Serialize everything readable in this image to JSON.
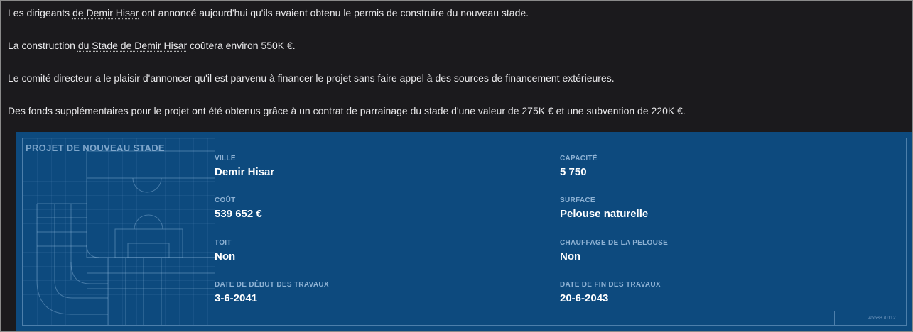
{
  "news": {
    "p1_before": "Les dirigeants ",
    "p1_link": "de Demir Hisar",
    "p1_after": " ont annoncé aujourd'hui qu'ils avaient obtenu le permis de construire du nouveau stade.",
    "p2_before": "La construction ",
    "p2_link": "du Stade de Demir Hisar",
    "p2_after": " coûtera environ 550K €.",
    "p3": "Le comité directeur a le plaisir d'annoncer qu'il est parvenu à financer le projet sans faire appel à des sources de financement extérieures.",
    "p4": "Des fonds supplémentaires pour le projet ont été obtenus grâce à un contrat de parrainage du stade d'une valeur de 275K € et une subvention de 220K €."
  },
  "panel": {
    "title": "PROJET DE NOUVEAU STADE",
    "ville": {
      "label": "VILLE",
      "value": "Demir Hisar"
    },
    "capacite": {
      "label": "CAPACITÉ",
      "value": "5 750"
    },
    "cout": {
      "label": "COÛT",
      "value": "539 652 €"
    },
    "surface": {
      "label": "SURFACE",
      "value": "Pelouse naturelle"
    },
    "toit": {
      "label": "TOIT",
      "value": "Non"
    },
    "chauffage": {
      "label": "CHAUFFAGE DE LA PELOUSE",
      "value": "Non"
    },
    "debut": {
      "label": "DATE DE DÉBUT DES TRAVAUX",
      "value": "3-6-2041"
    },
    "fin": {
      "label": "DATE DE FIN DES TRAVAUX",
      "value": "20-6-2043"
    },
    "ref": "45588 /0112"
  }
}
